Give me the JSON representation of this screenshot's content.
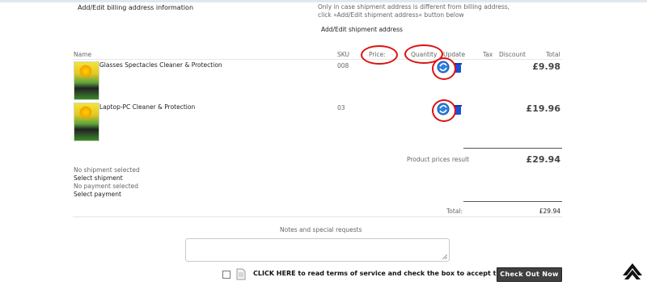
{
  "billing": {
    "link": "Add/Edit billing address information"
  },
  "shipment": {
    "note_line1": "Only in case shipment address is different from billing address,",
    "note_line2": "click »Add/Edit shipment address« button below",
    "link": "Add/Edit shipment address"
  },
  "cart": {
    "headers": {
      "name": "Name",
      "sku": "SKU",
      "price": "Price:",
      "quantity": "Quantity",
      "update": "Update",
      "tax": "Tax",
      "discount": "Discount",
      "total": "Total"
    },
    "rows": [
      {
        "name": "Glasses Spectacles Cleaner & Protection",
        "sku": "008",
        "total": "£9.98"
      },
      {
        "name": "Laptop-PC Cleaner & Protection",
        "sku": "03",
        "total": "£19.96"
      }
    ],
    "product_prices_label": "Product prices result",
    "product_prices_value": "£29.94",
    "total_label": "Total:",
    "total_value": "£29.94"
  },
  "selection": {
    "no_shipment": "No shipment selected",
    "select_shipment": "Select shipment",
    "no_payment": "No payment selected",
    "select_payment": "Select payment"
  },
  "notes": {
    "label": "Notes and special requests"
  },
  "terms": {
    "text": "CLICK HERE to read terms of service and check the box to accept them."
  },
  "checkout": {
    "label": "Check Out Now"
  },
  "colors": {
    "annotation": "#dd1111",
    "button": "#404040"
  },
  "icons": {
    "update": "refresh-icon",
    "delete": "trash-icon",
    "scroll_top": "chevron-up-icon",
    "terms": "document-icon"
  }
}
